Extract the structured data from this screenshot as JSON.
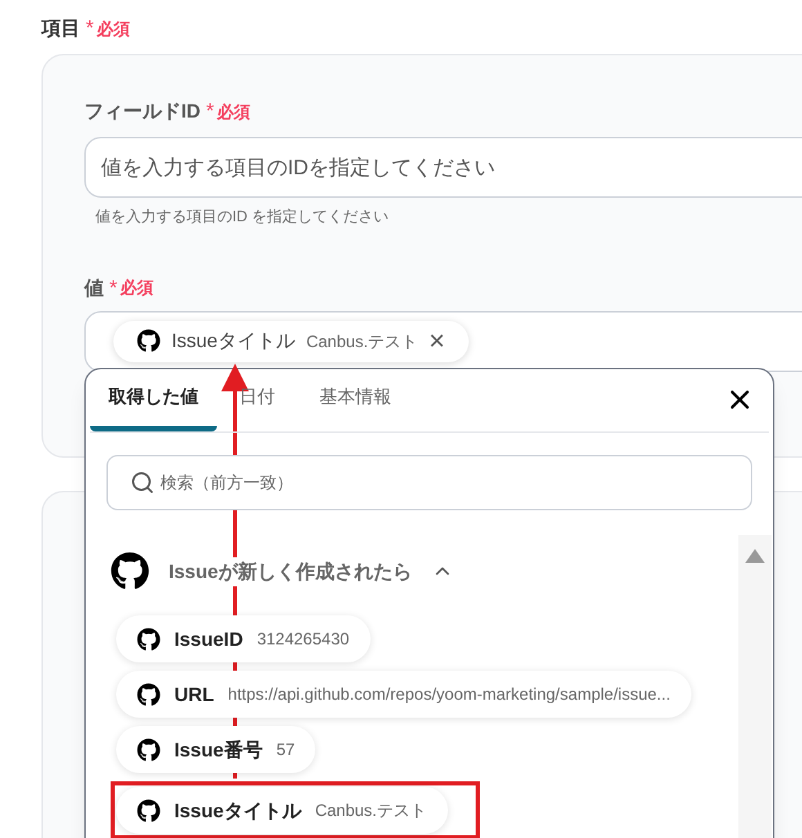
{
  "section": {
    "label": "項目",
    "required_mark": "*",
    "required": "必須"
  },
  "field_id": {
    "label": "フィールドID",
    "required_mark": "*",
    "required": "必須",
    "value": "値を入力する項目のIDを指定してください",
    "hint": "値を入力する項目のID を指定してください"
  },
  "value_field": {
    "label": "値",
    "required_mark": "*",
    "required": "必須",
    "chip": {
      "name": "Issueタイトル",
      "value": "Canbus.テスト",
      "close": "×"
    }
  },
  "popup": {
    "tabs": [
      {
        "label": "取得した値",
        "selected": true
      },
      {
        "label": "日付",
        "selected": false
      },
      {
        "label": "基本情報",
        "selected": false
      }
    ],
    "search": {
      "placeholder": "検索（前方一致）"
    },
    "group": {
      "title": "Issueが新しく作成されたら",
      "expanded": true
    },
    "items": [
      {
        "name": "IssueID",
        "value": "3124265430",
        "highlighted": false
      },
      {
        "name": "URL",
        "value": "https://api.github.com/repos/yoom-marketing/sample/issue...",
        "highlighted": false
      },
      {
        "name": "Issue番号",
        "value": "57",
        "highlighted": false
      },
      {
        "name": "Issueタイトル",
        "value": "Canbus.テスト",
        "highlighted": true
      }
    ]
  }
}
